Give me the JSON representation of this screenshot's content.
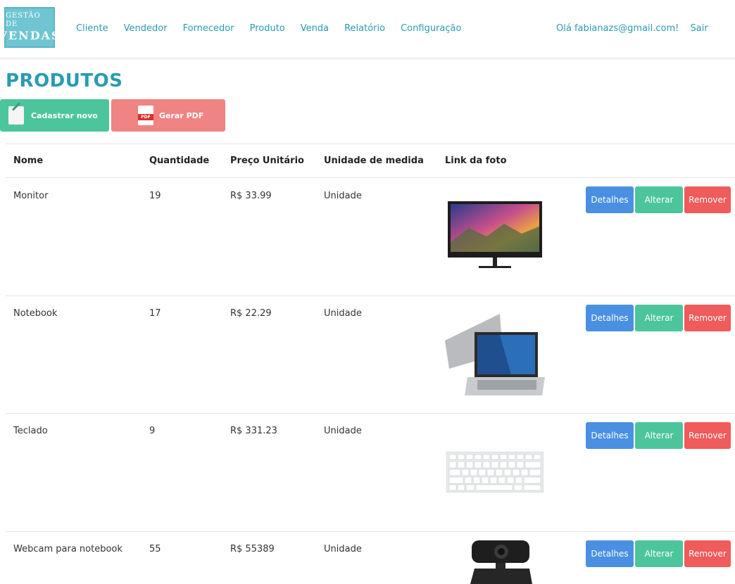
{
  "brand": {
    "logo_line1": "GESTÃO DE",
    "logo_line2": "VENDAS",
    "accent": "#2a9bb0"
  },
  "nav": {
    "items": [
      {
        "label": "Cliente"
      },
      {
        "label": "Vendedor"
      },
      {
        "label": "Fornecedor"
      },
      {
        "label": "Produto"
      },
      {
        "label": "Venda"
      },
      {
        "label": "Relatório"
      },
      {
        "label": "Configuração"
      }
    ]
  },
  "user": {
    "greeting": "Olá fabianazs@gmail.com!",
    "logout": "Sair"
  },
  "page": {
    "title": "PRODUTOS",
    "new_button": "Cadastrar novo",
    "pdf_button": "Gerar PDF",
    "pdf_icon_text": "PDF"
  },
  "table": {
    "headers": [
      "Nome",
      "Quantidade",
      "Preço Unitário",
      "Unidade de medida",
      "Link da foto"
    ],
    "rows": [
      {
        "name": "Monitor",
        "qty": "19",
        "price": "R$ 33.99",
        "unit": "Unidade",
        "photo": "monitor"
      },
      {
        "name": "Notebook",
        "qty": "17",
        "price": "R$ 22.29",
        "unit": "Unidade",
        "photo": "notebook"
      },
      {
        "name": "Teclado",
        "qty": "9",
        "price": "R$ 331.23",
        "unit": "Unidade",
        "photo": "keyboard"
      },
      {
        "name": "Webcam para notebook",
        "qty": "55",
        "price": "R$ 55389",
        "unit": "Unidade",
        "photo": "webcam"
      }
    ],
    "row_actions": {
      "details": "Detalhes",
      "edit": "Alterar",
      "remove": "Remover"
    }
  },
  "colors": {
    "details": "#4a90e2",
    "edit": "#4cc59d",
    "remove": "#f05b5b",
    "new": "#4cc59d",
    "pdf": "#f08383"
  }
}
